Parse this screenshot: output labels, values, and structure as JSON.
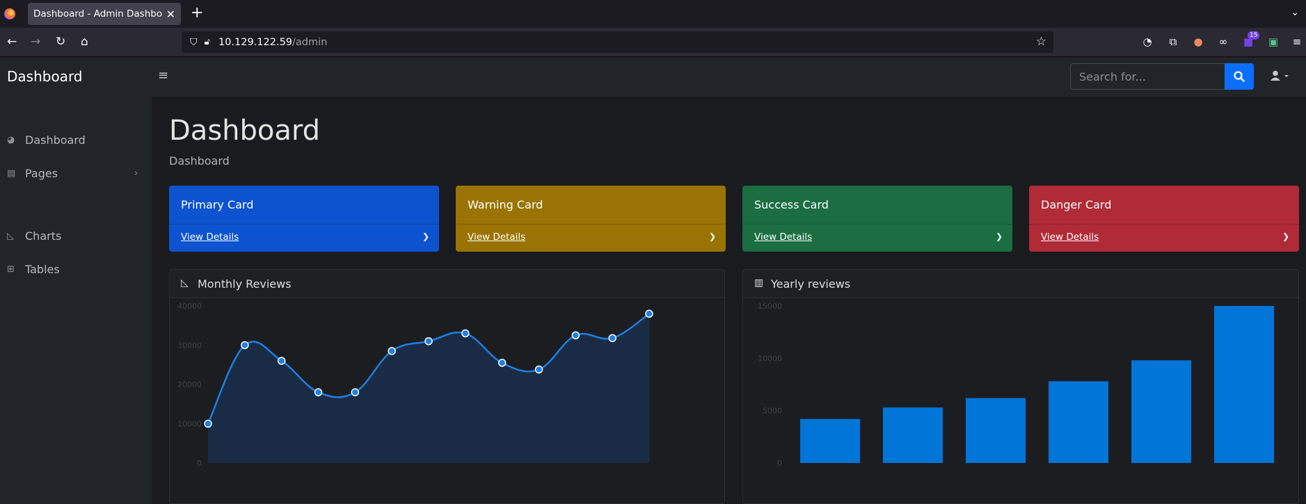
{
  "browser": {
    "tab_title": "Dashboard - Admin Dashboard",
    "url_host": "10.129.122.59",
    "url_path": "/admin",
    "ext_badge": "15"
  },
  "topnav": {
    "brand": "Dashboard",
    "search_placeholder": "Search for..."
  },
  "sidebar": {
    "items": [
      {
        "label": "Dashboard",
        "icon": "gauge-icon"
      },
      {
        "label": "Pages",
        "icon": "book-icon"
      },
      {
        "label": "Charts",
        "icon": "area-chart-icon"
      },
      {
        "label": "Tables",
        "icon": "table-icon"
      }
    ]
  },
  "main": {
    "title": "Dashboard",
    "breadcrumb": "Dashboard",
    "cards": [
      {
        "title": "Primary Card",
        "link": "View Details",
        "color": "#0d53cf"
      },
      {
        "title": "Warning Card",
        "link": "View Details",
        "color": "#997404"
      },
      {
        "title": "Success Card",
        "link": "View Details",
        "color": "#1a6e42"
      },
      {
        "title": "Danger Card",
        "link": "View Details",
        "color": "#b02a37"
      }
    ]
  },
  "chart_data": [
    {
      "type": "area",
      "title": "Monthly Reviews",
      "ylim": [
        0,
        40000
      ],
      "yticks": [
        0,
        10000,
        20000,
        30000,
        40000
      ],
      "values": [
        10000,
        30000,
        26000,
        18000,
        18000,
        28500,
        31000,
        33000,
        25500,
        23800,
        32500,
        31800,
        38000
      ],
      "color": "#0d6efd",
      "grid": false
    },
    {
      "type": "bar",
      "title": "Yearly reviews",
      "ylim": [
        0,
        15000
      ],
      "yticks": [
        0,
        5000,
        10000,
        15000
      ],
      "values": [
        4200,
        5300,
        6200,
        7800,
        9800,
        15000
      ],
      "color": "#0275d8",
      "grid": false
    }
  ]
}
